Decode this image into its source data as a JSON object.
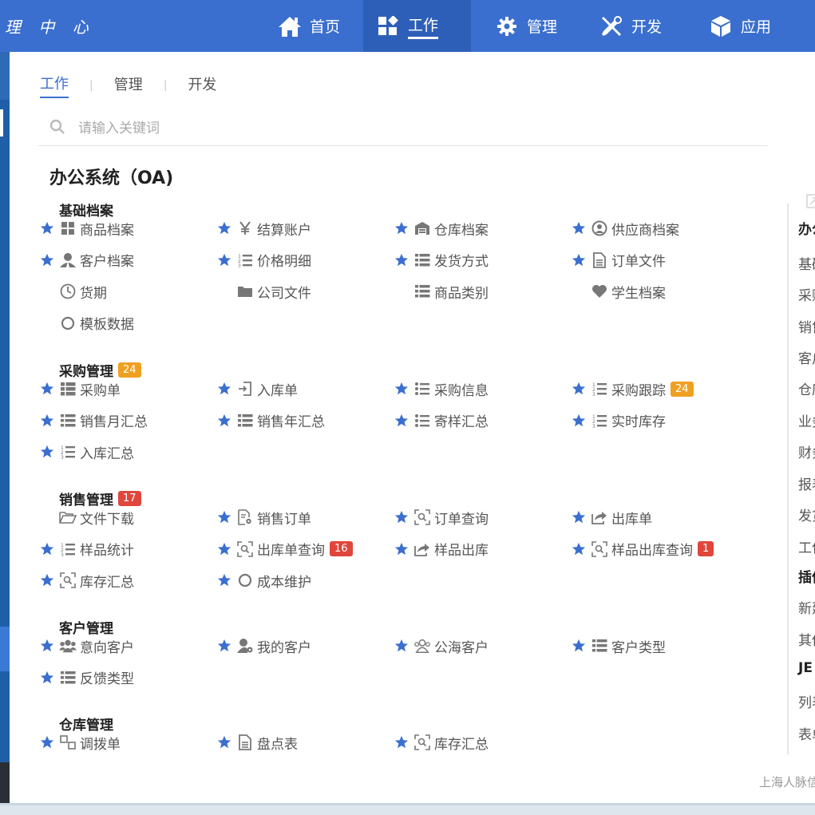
{
  "topbar": {
    "brand": "理 中 心",
    "nav": [
      {
        "label": "首页",
        "icon": "home-icon",
        "active": false
      },
      {
        "label": "工作",
        "icon": "apps-icon",
        "active": true
      },
      {
        "label": "管理",
        "icon": "gear-icon",
        "active": false
      },
      {
        "label": "开发",
        "icon": "tools-icon",
        "active": false
      },
      {
        "label": "应用",
        "icon": "cube-icon",
        "active": false
      }
    ]
  },
  "tabs": [
    "工作",
    "管理",
    "开发"
  ],
  "tab_sep": "|",
  "search": {
    "placeholder": "请输入关键词"
  },
  "system_title": "办公系统（OA)",
  "groups": [
    {
      "title": "基础档案",
      "badge": "",
      "items": [
        {
          "label": "商品档案",
          "icon": "grid-icon",
          "starred": true,
          "badge": ""
        },
        {
          "label": "结算账户",
          "icon": "yen-icon",
          "starred": true,
          "badge": ""
        },
        {
          "label": "仓库档案",
          "icon": "warehouse-icon",
          "starred": true,
          "badge": ""
        },
        {
          "label": "供应商档案",
          "icon": "user-circle-icon",
          "starred": true,
          "badge": ""
        },
        {
          "label": "客户档案",
          "icon": "user-tie-icon",
          "starred": true,
          "badge": ""
        },
        {
          "label": "价格明细",
          "icon": "ordered-list-icon",
          "starred": true,
          "badge": ""
        },
        {
          "label": "发货方式",
          "icon": "list-icon",
          "starred": true,
          "badge": ""
        },
        {
          "label": "订单文件",
          "icon": "file-text-icon",
          "starred": true,
          "badge": ""
        },
        {
          "label": "货期",
          "icon": "clock-icon",
          "starred": false,
          "badge": ""
        },
        {
          "label": "公司文件",
          "icon": "folder-icon",
          "starred": false,
          "badge": ""
        },
        {
          "label": "商品类别",
          "icon": "list-icon",
          "starred": false,
          "badge": ""
        },
        {
          "label": "学生档案",
          "icon": "heart-icon",
          "starred": false,
          "badge": ""
        },
        {
          "label": "模板数据",
          "icon": "circle-icon",
          "starred": false,
          "badge": ""
        }
      ]
    },
    {
      "title": "采购管理",
      "badge": "24",
      "badge_color": "#f0a020",
      "items": [
        {
          "label": "采购单",
          "icon": "th-list-icon",
          "starred": true,
          "badge": ""
        },
        {
          "label": "入库单",
          "icon": "sign-in-icon",
          "starred": true,
          "badge": ""
        },
        {
          "label": "采购信息",
          "icon": "list-ul-icon",
          "starred": true,
          "badge": ""
        },
        {
          "label": "采购跟踪",
          "icon": "ordered-list-icon",
          "starred": true,
          "badge": "24",
          "badge_color": "#f0a020"
        },
        {
          "label": "销售月汇总",
          "icon": "list-icon",
          "starred": true,
          "badge": ""
        },
        {
          "label": "销售年汇总",
          "icon": "list-icon",
          "starred": true,
          "badge": ""
        },
        {
          "label": "寄样汇总",
          "icon": "list-ul-icon",
          "starred": true,
          "badge": ""
        },
        {
          "label": "实时库存",
          "icon": "ordered-list-icon",
          "starred": true,
          "badge": ""
        },
        {
          "label": "入库汇总",
          "icon": "ordered-list-icon",
          "starred": true,
          "badge": ""
        }
      ]
    },
    {
      "title": "销售管理",
      "badge": "17",
      "badge_color": "#e0463c",
      "items": [
        {
          "label": "文件下载",
          "icon": "folder-open-icon",
          "starred": false,
          "badge": ""
        },
        {
          "label": "销售订单",
          "icon": "file-gear-icon",
          "starred": true,
          "badge": ""
        },
        {
          "label": "订单查询",
          "icon": "scan-search-icon",
          "starred": true,
          "badge": ""
        },
        {
          "label": "出库单",
          "icon": "share-icon",
          "starred": true,
          "badge": ""
        },
        {
          "label": "样品统计",
          "icon": "ordered-list-icon",
          "starred": true,
          "badge": ""
        },
        {
          "label": "出库单查询",
          "icon": "scan-search-icon",
          "starred": true,
          "badge": "16",
          "badge_color": "#e0463c"
        },
        {
          "label": "样品出库",
          "icon": "share-icon",
          "starred": true,
          "badge": ""
        },
        {
          "label": "样品出库查询",
          "icon": "scan-search-icon",
          "starred": true,
          "badge": "1",
          "badge_color": "#e0463c"
        },
        {
          "label": "库存汇总",
          "icon": "scan-search-icon",
          "starred": true,
          "badge": ""
        },
        {
          "label": "成本维护",
          "icon": "circle-icon",
          "starred": true,
          "badge": ""
        }
      ]
    },
    {
      "title": "客户管理",
      "badge": "",
      "items": [
        {
          "label": "意向客户",
          "icon": "users-icon",
          "starred": true,
          "badge": ""
        },
        {
          "label": "我的客户",
          "icon": "user-gear-icon",
          "starred": true,
          "badge": ""
        },
        {
          "label": "公海客户",
          "icon": "users-outline-icon",
          "starred": true,
          "badge": ""
        },
        {
          "label": "客户类型",
          "icon": "list-icon",
          "starred": true,
          "badge": ""
        },
        {
          "label": "反馈类型",
          "icon": "list-icon",
          "starred": true,
          "badge": ""
        }
      ]
    },
    {
      "title": "仓库管理",
      "badge": "",
      "items": [
        {
          "label": "调拨单",
          "icon": "exchange-icon",
          "starred": true,
          "badge": ""
        },
        {
          "label": "盘点表",
          "icon": "file-text-icon",
          "starred": true,
          "badge": ""
        },
        {
          "label": "库存汇总",
          "icon": "scan-search-icon",
          "starred": true,
          "badge": ""
        }
      ]
    }
  ],
  "right_column": {
    "items": [
      "办公",
      "基础",
      "采购",
      "销售",
      "客户",
      "仓库",
      "业务",
      "财务",
      "报表",
      "发货",
      "工作",
      "插件",
      "新建",
      "其他",
      "JE",
      "列表",
      "表单"
    ]
  },
  "footer": "上海人脉信息"
}
